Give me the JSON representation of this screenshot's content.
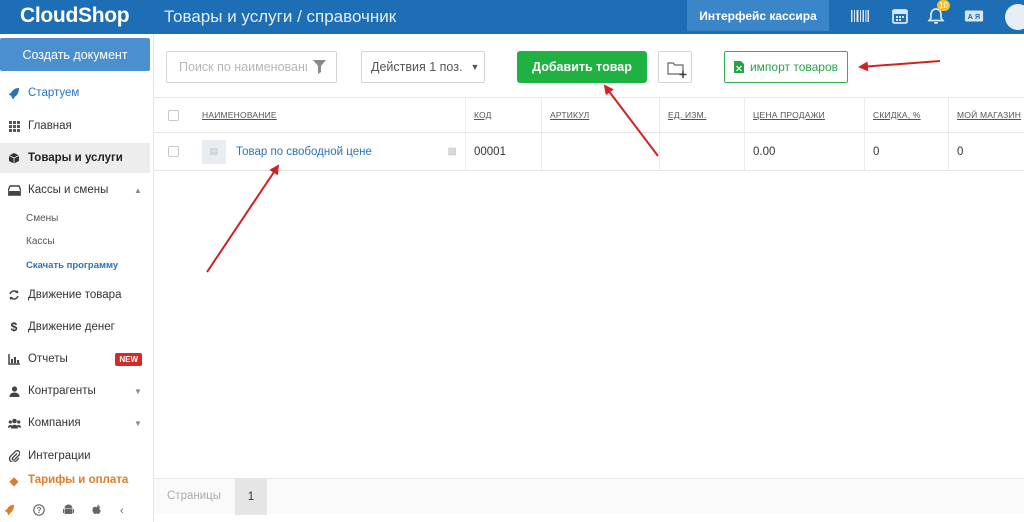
{
  "app": {
    "logo": "CloudShop",
    "title": "Товары и услуги / справочник",
    "cashier_button": "Интерфейс кассира",
    "notif_count": "10"
  },
  "sidebar": {
    "create_button": "Создать документ",
    "items": [
      {
        "label": "Стартуем",
        "icon": "rocket-icon",
        "color": "#2a73b8"
      },
      {
        "label": "Главная",
        "icon": "grid-icon"
      },
      {
        "label": "Товары и услуги",
        "icon": "box-icon"
      },
      {
        "label": "Кассы и смены",
        "icon": "cashbox-icon"
      },
      {
        "label": "Движение товара",
        "icon": "refresh-icon"
      },
      {
        "label": "Движение денег",
        "icon": "dollar-icon"
      },
      {
        "label": "Отчеты",
        "icon": "chart-icon",
        "badge": "NEW"
      },
      {
        "label": "Контрагенты",
        "icon": "user-icon"
      },
      {
        "label": "Компания",
        "icon": "users-icon"
      },
      {
        "label": "Интеграции",
        "icon": "paperclip-icon"
      },
      {
        "label": "Тарифы и оплата",
        "icon": "tag-icon"
      }
    ],
    "subitems": [
      "Смены",
      "Кассы",
      "Скачать программу"
    ]
  },
  "toolbar": {
    "search_placeholder": "Поиск по наименованию",
    "actions_label": "Действия 1 поз.",
    "add_button": "Добавить товар",
    "import_button": "импорт товаров"
  },
  "table": {
    "columns": [
      "НАИМЕНОВАНИЕ",
      "КОД",
      "АРТИКУЛ",
      "ЕД. ИЗМ.",
      "ЦЕНА ПРОДАЖИ",
      "СКИДКА, %",
      "МОЙ МАГАЗИН"
    ],
    "rows": [
      {
        "name": "Товар по свободной цене",
        "code": "00001",
        "sku": "",
        "unit": "",
        "price": "0.00",
        "discount": "0",
        "store": "0"
      }
    ]
  },
  "pager": {
    "label": "Страницы",
    "page": "1"
  },
  "colors": {
    "topbar": "#1d6eb5",
    "add_button": "#1fb141",
    "link": "#2a73b8",
    "arrow": "#d42121"
  }
}
